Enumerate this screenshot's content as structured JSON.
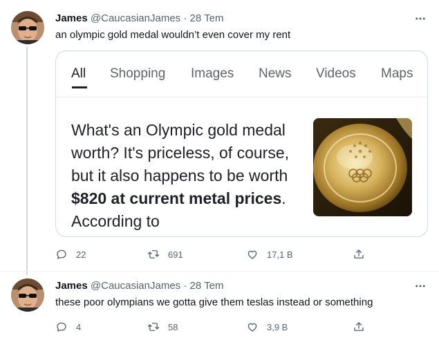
{
  "tweets": [
    {
      "name": "James",
      "handle": "@CaucasianJames",
      "dot": "·",
      "date": "28 Tem",
      "text": "an olympic gold medal wouldn’t even cover my rent",
      "card": {
        "tabs": [
          {
            "label": "All",
            "active": true
          },
          {
            "label": "Shopping",
            "active": false
          },
          {
            "label": "Images",
            "active": false
          },
          {
            "label": "News",
            "active": false
          },
          {
            "label": "Videos",
            "active": false
          },
          {
            "label": "Maps",
            "active": false
          }
        ],
        "snippet": {
          "part1": "What's an Olympic gold medal worth? It's priceless, of course, but it also happens to be worth ",
          "bold1": "$820 at current",
          "bold2": "metal prices",
          "part2": ". According to"
        },
        "image_alt": "gold medal"
      },
      "replies": "22",
      "retweets": "691",
      "likes": "17,1 B"
    },
    {
      "name": "James",
      "handle": "@CaucasianJames",
      "dot": "·",
      "date": "28 Tem",
      "text": "these poor olympians we gotta give them teslas instead or something",
      "replies": "4",
      "retweets": "58",
      "likes": "3,9 B"
    }
  ],
  "colors": {
    "text_primary": "#0f1419",
    "text_secondary": "#536471",
    "thread_line": "#cfd9de",
    "medal_gold": "#c9a24a"
  },
  "icons": [
    "avatar",
    "more-icon",
    "reply-icon",
    "retweet-icon",
    "like-icon",
    "share-icon"
  ]
}
